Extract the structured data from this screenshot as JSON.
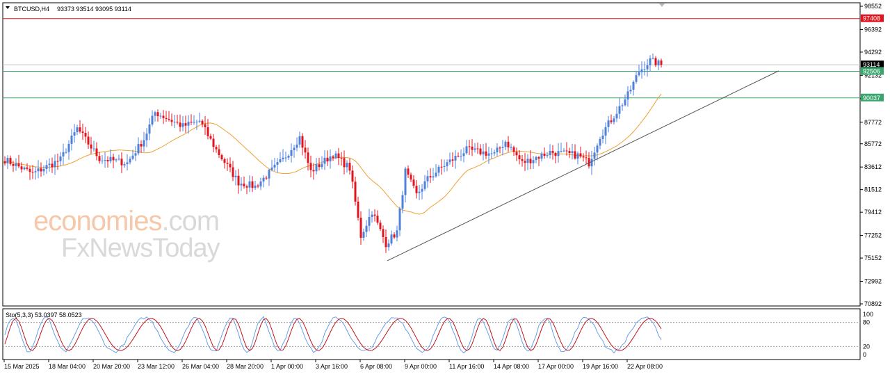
{
  "header": {
    "symbol": "BTCUSD,H4",
    "ohlc": "93373 93514 93095 93114"
  },
  "watermark": {
    "line1_main": "economies",
    "line1_suffix": ".com",
    "line2": "FxNewsToday"
  },
  "indicator": {
    "label": "Sto(5,3,3) 53.0397 58.0523",
    "ticks": [
      "100",
      "80",
      "20",
      "0"
    ]
  },
  "price_labels": {
    "current": "93114",
    "red_line": "97408",
    "green_upper": "92506",
    "green_lower": "90037"
  },
  "colors": {
    "bull": "#4f81d9",
    "bear": "#e0141e",
    "ma": "#f0a030",
    "red_line": "#e0141e",
    "green_line": "#3aa66e",
    "trendline": "#555555",
    "stoch_main": "#6a9ee8",
    "stoch_signal": "#c0141e"
  },
  "chart_data": {
    "type": "candlestick",
    "symbol": "BTCUSD",
    "timeframe": "H4",
    "ylim": [
      70892,
      98552
    ],
    "y_ticks": [
      98552,
      96392,
      94292,
      92132,
      89972,
      87772,
      85772,
      83612,
      81512,
      79412,
      77252,
      75152,
      72992,
      70892
    ],
    "x_tick_labels": [
      "15 Mar 2025",
      "18 Mar 04:00",
      "20 Mar 20:00",
      "23 Mar 12:00",
      "26 Mar 04:00",
      "28 Mar 20:00",
      "1 Apr 00:00",
      "3 Apr 16:00",
      "6 Apr 08:00",
      "9 Apr 00:00",
      "11 Apr 16:00",
      "14 Apr 08:00",
      "17 Apr 00:00",
      "19 Apr 16:00",
      "22 Apr 08:00"
    ],
    "horizontal_levels": [
      {
        "value": 97408,
        "color": "red"
      },
      {
        "value": 93114,
        "color": "gray"
      },
      {
        "value": 92506,
        "color": "green"
      },
      {
        "value": 90037,
        "color": "green"
      }
    ],
    "trendline": {
      "from": {
        "bar": 137,
        "price": 74900
      },
      "to": {
        "bar": 262,
        "price": 92550
      }
    },
    "close_anchors": [
      [
        0,
        84300
      ],
      [
        10,
        83000
      ],
      [
        20,
        84300
      ],
      [
        26,
        87200
      ],
      [
        34,
        84400
      ],
      [
        44,
        84000
      ],
      [
        50,
        86200
      ],
      [
        54,
        88700
      ],
      [
        64,
        87400
      ],
      [
        70,
        87900
      ],
      [
        76,
        85200
      ],
      [
        84,
        82200
      ],
      [
        90,
        81800
      ],
      [
        100,
        84300
      ],
      [
        106,
        86400
      ],
      [
        110,
        83200
      ],
      [
        118,
        84800
      ],
      [
        124,
        83500
      ],
      [
        128,
        77200
      ],
      [
        132,
        79500
      ],
      [
        137,
        76500
      ],
      [
        141,
        77600
      ],
      [
        144,
        83200
      ],
      [
        148,
        81000
      ],
      [
        152,
        82500
      ],
      [
        158,
        83800
      ],
      [
        166,
        85200
      ],
      [
        176,
        84800
      ],
      [
        180,
        86000
      ],
      [
        186,
        84000
      ],
      [
        196,
        85000
      ],
      [
        206,
        84700
      ],
      [
        210,
        84000
      ],
      [
        214,
        86500
      ],
      [
        218,
        88000
      ],
      [
        224,
        90300
      ],
      [
        228,
        92500
      ],
      [
        232,
        93500
      ],
      [
        236,
        93114
      ]
    ],
    "indicator": {
      "name": "Sto(5,3,3)",
      "main": 53.0397,
      "signal": 58.0523,
      "levels": [
        80,
        20
      ],
      "ylim": [
        0,
        100
      ]
    }
  }
}
